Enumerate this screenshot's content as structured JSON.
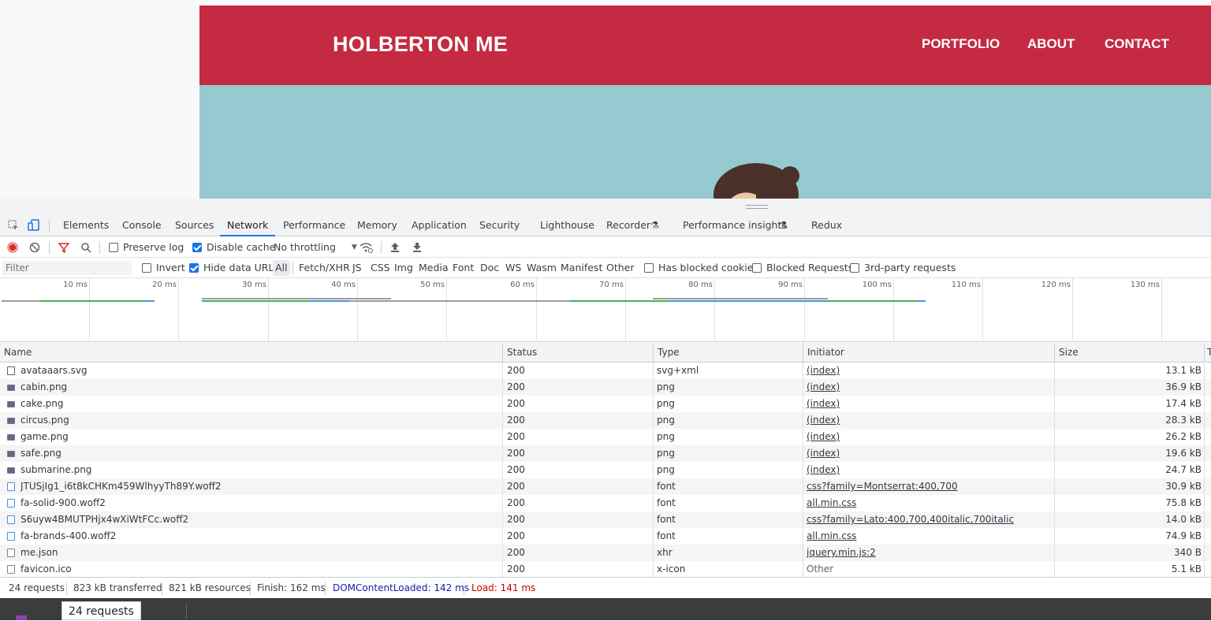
{
  "site": {
    "logo": "HOLBERTON ME",
    "nav": [
      "PORTFOLIO",
      "ABOUT",
      "CONTACT"
    ],
    "colors": {
      "header": "#c42a41",
      "hero": "#96c9d0"
    }
  },
  "devtools": {
    "tabs": [
      "Elements",
      "Console",
      "Sources",
      "Network",
      "Performance",
      "Memory",
      "Application",
      "Security",
      "Lighthouse",
      "Recorder",
      "Performance insights",
      "Redux"
    ],
    "active_tab": "Network",
    "toolbar": {
      "preserve_log": "Preserve log",
      "disable_cache": "Disable cache",
      "throttling": "No throttling"
    },
    "filter": {
      "placeholder": "Filter",
      "invert": "Invert",
      "hide_data_urls": "Hide data URLs",
      "types": [
        "All",
        "Fetch/XHR",
        "JS",
        "CSS",
        "Img",
        "Media",
        "Font",
        "Doc",
        "WS",
        "Wasm",
        "Manifest",
        "Other"
      ],
      "has_blocked_cookies": "Has blocked cookies",
      "blocked_requests": "Blocked Requests",
      "third_party": "3rd-party requests"
    },
    "timeline_ticks": [
      "10 ms",
      "20 ms",
      "30 ms",
      "40 ms",
      "50 ms",
      "60 ms",
      "70 ms",
      "80 ms",
      "90 ms",
      "100 ms",
      "110 ms",
      "120 ms",
      "130 ms"
    ],
    "columns": [
      "Name",
      "Status",
      "Type",
      "Initiator",
      "Size"
    ],
    "requests": [
      {
        "name": "avataaars.svg",
        "status": "200",
        "type": "svg+xml",
        "initiator": "(index)",
        "size": "13.1 kB",
        "icon": "svg"
      },
      {
        "name": "cabin.png",
        "status": "200",
        "type": "png",
        "initiator": "(index)",
        "size": "36.9 kB",
        "icon": "img"
      },
      {
        "name": "cake.png",
        "status": "200",
        "type": "png",
        "initiator": "(index)",
        "size": "17.4 kB",
        "icon": "img"
      },
      {
        "name": "circus.png",
        "status": "200",
        "type": "png",
        "initiator": "(index)",
        "size": "28.3 kB",
        "icon": "img"
      },
      {
        "name": "game.png",
        "status": "200",
        "type": "png",
        "initiator": "(index)",
        "size": "26.2 kB",
        "icon": "img"
      },
      {
        "name": "safe.png",
        "status": "200",
        "type": "png",
        "initiator": "(index)",
        "size": "19.6 kB",
        "icon": "img"
      },
      {
        "name": "submarine.png",
        "status": "200",
        "type": "png",
        "initiator": "(index)",
        "size": "24.7 kB",
        "icon": "img"
      },
      {
        "name": "JTUSjIg1_i6t8kCHKm459WlhyyTh89Y.woff2",
        "status": "200",
        "type": "font",
        "initiator": "css?family=Montserrat:400,700",
        "size": "30.9 kB",
        "icon": "font"
      },
      {
        "name": "fa-solid-900.woff2",
        "status": "200",
        "type": "font",
        "initiator": "all.min.css",
        "size": "75.8 kB",
        "icon": "font"
      },
      {
        "name": "S6uyw4BMUTPHjx4wXiWtFCc.woff2",
        "status": "200",
        "type": "font",
        "initiator": "css?family=Lato:400,700,400italic,700italic",
        "size": "14.0 kB",
        "icon": "font"
      },
      {
        "name": "fa-brands-400.woff2",
        "status": "200",
        "type": "font",
        "initiator": "all.min.css",
        "size": "74.9 kB",
        "icon": "font"
      },
      {
        "name": "me.json",
        "status": "200",
        "type": "xhr",
        "initiator": "jquery.min.js:2",
        "size": "340 B",
        "icon": "doc"
      },
      {
        "name": "favicon.ico",
        "status": "200",
        "type": "x-icon",
        "initiator": "Other",
        "size": "5.1 kB",
        "icon": "doc"
      }
    ],
    "status": {
      "requests": "24 requests",
      "transferred": "823 kB transferred",
      "resources": "821 kB resources",
      "finish": "Finish: 162 ms",
      "dom_loaded": "DOMContentLoaded: 142 ms",
      "load": "Load: 141 ms"
    },
    "colors": {
      "dom_loaded": "#1a1aa6",
      "load": "#c80000",
      "active_tab": "#1a73e8"
    }
  },
  "tooltip": "24 requests"
}
